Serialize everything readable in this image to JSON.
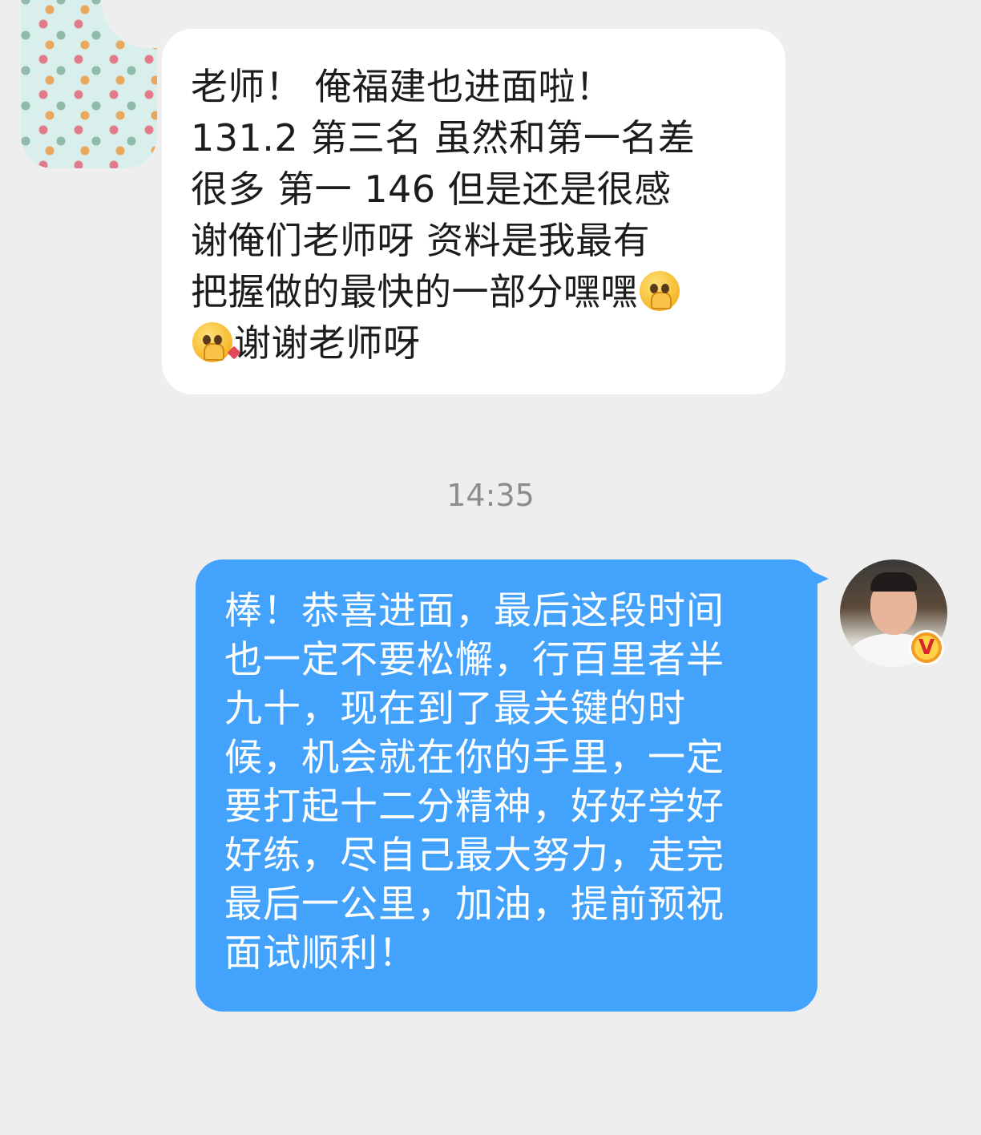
{
  "incoming": {
    "lines": [
      "老师！ 俺福建也进面啦！",
      "131.2 第三名 虽然和第一名差",
      "很多 第一 146 但是还是很感",
      "谢俺们老师呀 资料是我最有",
      "把握做的最快的一部分嘿嘿",
      "谢谢老师呀"
    ],
    "emoji_icons": [
      "pleading-praying-emoji-icon",
      "blushing-love-emoji-icon"
    ]
  },
  "timestamp": "14:35",
  "outgoing": {
    "lines": [
      "棒！恭喜进面，最后这段时间",
      "也一定不要松懈，行百里者半",
      "九十，现在到了最关键的时",
      "候，机会就在你的手里，一定",
      "要打起十二分精神，好好学好",
      "好练，尽自己最大努力，走完",
      "最后一公里，加油，提前预祝",
      "面试顺利！"
    ],
    "bubble_color": "#43a2fb",
    "verified_badge": "V"
  }
}
